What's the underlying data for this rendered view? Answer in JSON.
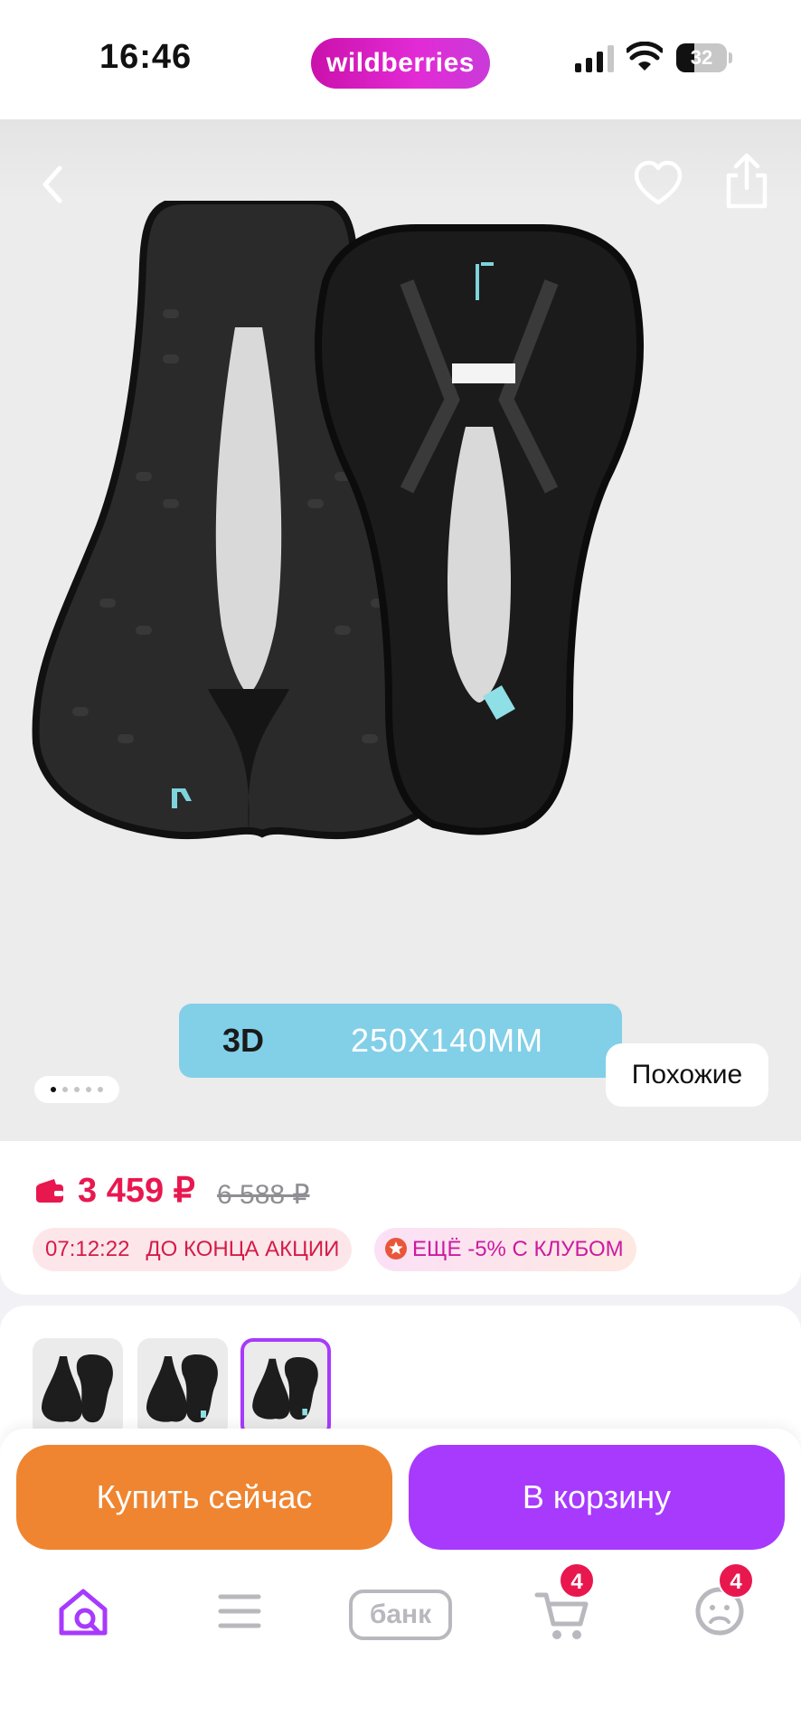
{
  "status_bar": {
    "time": "16:46",
    "brand": "wildberries",
    "battery_level": "32"
  },
  "gallery": {
    "spec_banner": {
      "mode": "3D",
      "size": "250X140MM"
    },
    "similar_label": "Похожие",
    "page_count": 5,
    "current_page": 1,
    "icons": [
      "back-icon",
      "heart-icon",
      "share-icon"
    ]
  },
  "price": {
    "current": "3 459 ₽",
    "old": "6 588 ₽",
    "timer": "07:12:22",
    "timer_label": "ДО КОНЦА АКЦИИ",
    "club_offer": "ЕЩЁ -5% С КЛУБОМ"
  },
  "variants": {
    "count": 3,
    "selected_index": 2
  },
  "actions": {
    "buy_now": "Купить сейчас",
    "add_to_cart": "В корзину"
  },
  "tab_bar": {
    "home_icon": "home-search-icon",
    "catalog_icon": "menu-icon",
    "bank_label": "банк",
    "cart_badge": "4",
    "profile_badge": "4"
  },
  "colors": {
    "brand": "#cb11ab",
    "price": "#e8184f",
    "buy_now": "#ef8530",
    "add_to_cart": "#a73afd",
    "spec_banner": "#82cfe8"
  }
}
